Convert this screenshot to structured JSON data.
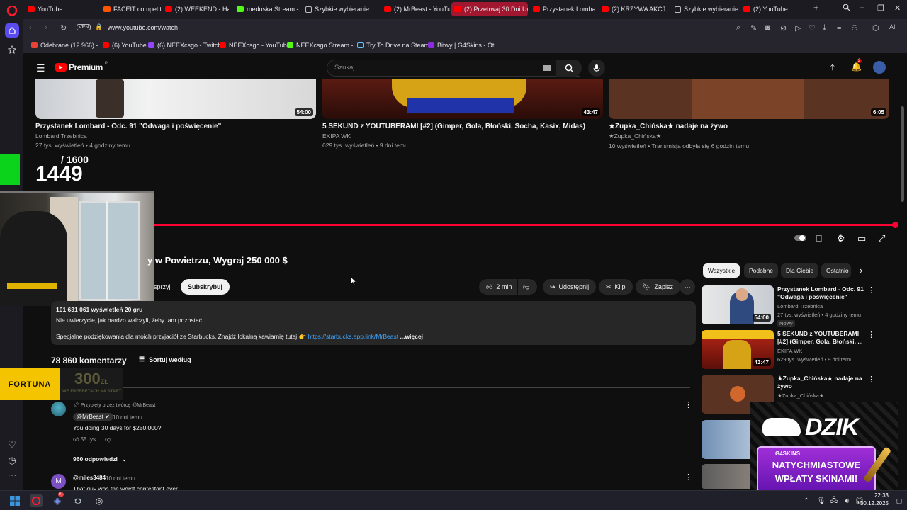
{
  "browser": {
    "tabs": [
      {
        "label": "YouTube",
        "icon": "youtube-favicon"
      },
      {
        "label": "FACEIT competitive m",
        "icon": "faceit-favicon"
      },
      {
        "label": "(2) WEEKEND - Halo t",
        "icon": "youtube-favicon"
      },
      {
        "label": "meduska Stream - Wa",
        "icon": "kick-favicon"
      },
      {
        "label": "Szybkie wybieranie",
        "icon": "speed-dial-icon"
      },
      {
        "label": "(2) MrBeast - YouTube",
        "icon": "youtube-favicon"
      },
      {
        "label": "(2) Przetrwaj 30 Dni Uwię",
        "icon": "youtube-favicon",
        "active": true
      },
      {
        "label": "Przystanek Lombard",
        "icon": "youtube-favicon"
      },
      {
        "label": "(2) KRZYWA AKCJA #",
        "icon": "youtube-favicon"
      },
      {
        "label": "Szybkie wybieranie",
        "icon": "speed-dial-icon"
      },
      {
        "label": "(2) YouTube",
        "icon": "youtube-favicon"
      }
    ],
    "vpn_label": "VPN",
    "url": "www.youtube.com/watch",
    "ai_label": "AI",
    "bookmarks": [
      {
        "label": "Odebrane (12 966) -...",
        "icon": "gmail-favicon"
      },
      {
        "label": "(6) YouTube",
        "icon": "youtube-favicon"
      },
      {
        "label": "(6) NEEXcsgo - Twitch",
        "icon": "twitch-favicon"
      },
      {
        "label": "NEEXcsgo - YouTube",
        "icon": "youtube-favicon"
      },
      {
        "label": "NEEXcsgo Stream -...",
        "icon": "kick-favicon"
      },
      {
        "label": "Try To Drive na Steam",
        "icon": "steam-favicon"
      },
      {
        "label": "Bitwy | G4Skins - Ot...",
        "icon": "g4skins-favicon"
      }
    ]
  },
  "youtube": {
    "logo_label": "Premium",
    "logo_region": "PL",
    "search_placeholder": "Szukaj",
    "notification_count": "2"
  },
  "top_videos": [
    {
      "title": "Przystanek Lombard - Odc. 91 \"Odwaga i poświęcenie\"",
      "channel": "Lombard Trzebnica",
      "meta": "27 tys. wyświetleń • 4 godziny temu",
      "duration": "54:00"
    },
    {
      "title": "5 SEKUND z YOUTUBERAMI [#2] (Gimper, Gola, Błoński, Socha, Kasix, Midas)",
      "channel": "EKIPA WK",
      "meta": "629 tys. wyświetleń • 9 dni temu",
      "duration": "43:47"
    },
    {
      "title": "★Zupka_Chińska★ nadaje na żywo",
      "channel": "★Zupka_Chińska★",
      "meta": "10 wyświetleń • Transmisja odbyła się 6 godzin temu",
      "duration": "6:05"
    }
  ],
  "overlay": {
    "counter_total": "/ 1600",
    "counter_value": "1449"
  },
  "video": {
    "title_visible": "y w Powietrzu, Wygraj 250 000 $",
    "support_partial": "sprzyj",
    "subscribe_label": "Subskrybuj",
    "likes": "2 mln",
    "share_label": "Udostępnij",
    "clip_label": "Klip",
    "save_label": "Zapisz",
    "progress": 1.0
  },
  "description": {
    "views_date": "101 631 061 wyświetleń  20 gru",
    "line1": "Nie uwierzycie, jak bardzo walczyli, żeby tam pozostać.",
    "line2": "Specjalne podziękowania dla moich przyjaciół ze Starbucks. Znajdź lokalną kawiarnię tutaj 👉",
    "link": "https://starbucks.app.link/MrBeast",
    "more": "...więcej"
  },
  "comments": {
    "count_label": "78 860 komentarzy",
    "sort_label": "Sortuj według",
    "pinned_label": "Przypięty przez twórcę @MrBeast",
    "first": {
      "author": "@MrBeast",
      "time": "10 dni temu",
      "text": "You doing 30 days for $250,000?",
      "likes": "55 tys.",
      "replies": "960 odpowiedzi"
    },
    "second": {
      "author": "@miles3484",
      "time": "10 dni temu",
      "avatar_letter": "M",
      "text_partial": "That guy was the worst contestant ever"
    }
  },
  "sidebar": {
    "chips": [
      "Wszystkie",
      "Podobne",
      "Dla Ciebie",
      "Ostatnio"
    ],
    "recommendations": [
      {
        "title": "Przystanek Lombard - Odc. 91 \"Odwaga i poświęcenie\"",
        "channel": "Lombard Trzebnica",
        "meta": "27 tys. wyświetleń • 4 godziny temu",
        "badge": "Nowy",
        "duration": "54:00"
      },
      {
        "title": "5 SEKUND z YOUTUBERAMI [#2] (Gimper, Gola, Błoński, ...",
        "channel": "EKIPA WK",
        "meta": "629 tys. wyświetleń • 9 dni temu",
        "duration": "43:47"
      },
      {
        "title": "★Zupka_Chińska★ nadaje na żywo",
        "channel": "★Zupka_Chińska★"
      }
    ]
  },
  "ads": {
    "fortuna_brand": "FORTUNA",
    "fortuna_amount": "300",
    "fortuna_currency": "ZŁ",
    "fortuna_sub": "WE FREEBETACH NA START",
    "dzik_brand": "DZIK",
    "g4_brand": "G4SKINS",
    "g4_line1": "NATYCHMIASTOWE",
    "g4_line2": "WPŁATY SKINAMI!"
  },
  "taskbar": {
    "time": "22:33",
    "date": "30.12.2025",
    "discord_badge": "9+"
  },
  "colors": {
    "yt_red": "#ff0000",
    "progress_red": "#ff0033",
    "active_tab": "#a0172f",
    "link_blue": "#3ea6ff",
    "bg": "#0f0f0f"
  }
}
